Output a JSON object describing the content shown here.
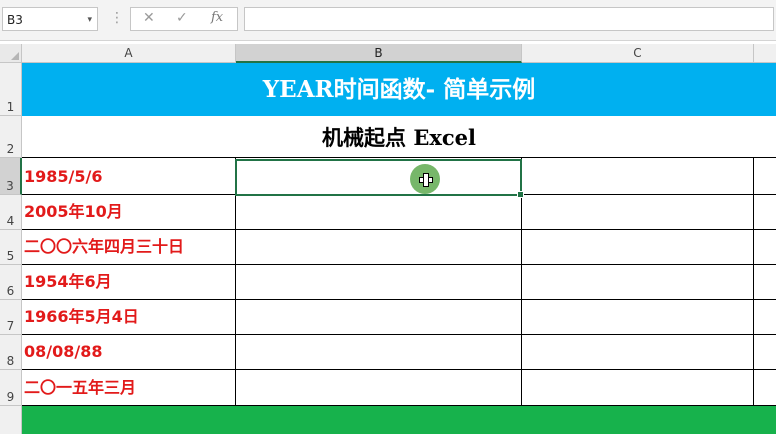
{
  "formula_bar": {
    "name_box": "B3",
    "name_box_dropdown": "▾",
    "separator": "⋮",
    "cancel_glyph": "✕",
    "enter_glyph": "✓",
    "fx_glyph": "fx",
    "formula_value": ""
  },
  "columns": [
    "A",
    "B",
    "C"
  ],
  "rows": [
    "1",
    "2",
    "3",
    "4",
    "5",
    "6",
    "7",
    "8",
    "9"
  ],
  "sheet": {
    "title": "YEAR时间函数- 简单示例",
    "subtitle": "机械起点 Excel",
    "dates": [
      "1985/5/6",
      "2005年10月",
      "二〇〇六年四月三十日",
      "1954年6月",
      "1966年5月4日",
      "08/08/88",
      "二〇一五年三月"
    ]
  },
  "colors": {
    "title_band": "#00b0f0",
    "footer_band": "#17b24c",
    "date_text": "#e21a1a",
    "selection": "#217346"
  },
  "icons": {
    "cursor": "move-cross-cursor-icon",
    "cancel": "cancel-x-icon",
    "enter": "checkmark-icon",
    "function": "fx-icon"
  }
}
